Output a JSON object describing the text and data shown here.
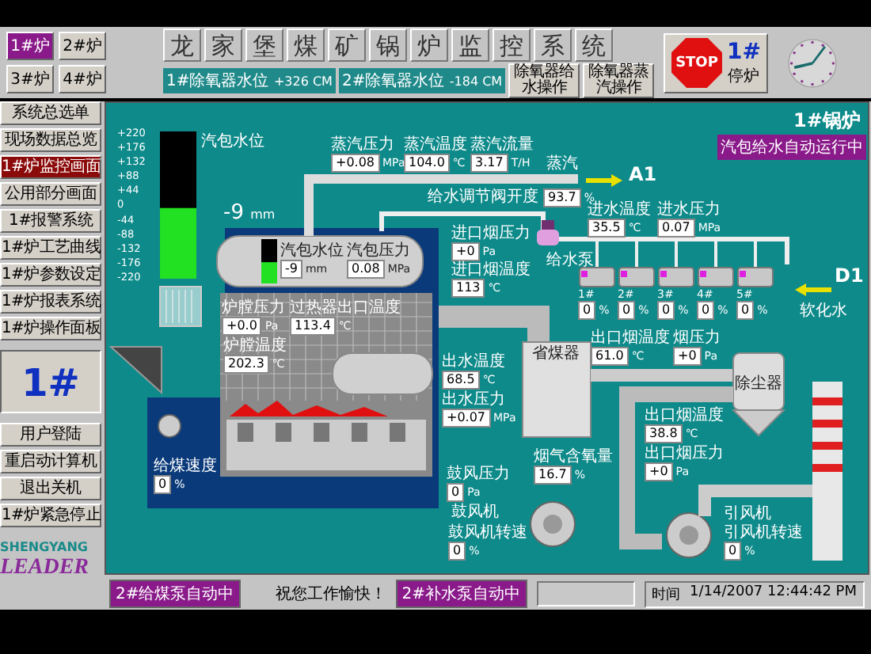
{
  "boiler_tabs": [
    {
      "label": "1#炉",
      "selected": true
    },
    {
      "label": "2#炉",
      "selected": false
    },
    {
      "label": "3#炉",
      "selected": false
    },
    {
      "label": "4#炉",
      "selected": false
    }
  ],
  "title": "龙家堡煤矿锅炉监控系统",
  "deaerator_levels": [
    {
      "label": "1#除氧器水位",
      "value": "+326 CM"
    },
    {
      "label": "2#除氧器水位",
      "value": "-184 CM"
    }
  ],
  "deaerator_buttons": [
    "除氧器给水操作",
    "除氧器蒸汽操作"
  ],
  "stop": {
    "label": "STOP",
    "unit": "1#",
    "caption": "停炉"
  },
  "sidebar": {
    "items": [
      {
        "label": "系统总选单",
        "selected": false
      },
      {
        "label": "现场数据总览",
        "selected": false
      },
      {
        "label": "1#炉监控画面",
        "selected": true
      },
      {
        "label": "公用部分画面",
        "selected": false
      },
      {
        "label": "1#报警系统",
        "selected": false
      },
      {
        "label": "1#炉工艺曲线",
        "selected": false
      },
      {
        "label": "1#炉参数设定",
        "selected": false
      },
      {
        "label": "1#炉报表系统",
        "selected": false
      },
      {
        "label": "1#炉操作面板",
        "selected": false
      }
    ],
    "unit": "1#",
    "actions": [
      "用户登陆",
      "重启动计算机",
      "退出关机",
      "1#炉紧急停止"
    ]
  },
  "logo": {
    "line1": "SHENGYANG",
    "line2": "LEADER"
  },
  "panel": {
    "title": "1#锅炉",
    "badge": "汽包给水自动运行中",
    "gauge": {
      "label": "汽包水位",
      "ticks": [
        "+220",
        "+176",
        "+132",
        "+88",
        "+44",
        "0",
        "-44",
        "-88",
        "-132",
        "-176",
        "-220"
      ],
      "level": 0.48,
      "reading": "-9",
      "unit": "mm"
    },
    "readouts": [
      {
        "label": "蒸汽压力",
        "value": "+0.08",
        "unit": "MPa"
      },
      {
        "label": "蒸汽温度",
        "value": "104.0",
        "unit": "℃"
      },
      {
        "label": "蒸汽流量",
        "value": "3.17",
        "unit": "T/H"
      },
      {
        "label": "给水调节阀开度",
        "value": "93.7",
        "unit": "%"
      },
      {
        "label": "进水温度",
        "value": "35.5",
        "unit": "℃"
      },
      {
        "label": "进水压力",
        "value": "0.07",
        "unit": "MPa"
      },
      {
        "label": "汽包水位",
        "value": "-9",
        "unit": "mm"
      },
      {
        "label": "汽包压力",
        "value": "0.08",
        "unit": "MPa"
      },
      {
        "label": "炉膛压力",
        "value": "+0.0",
        "unit": "Pa"
      },
      {
        "label": "过热器出口温度",
        "value": "113.4",
        "unit": "℃"
      },
      {
        "label": "炉膛温度",
        "value": "202.3",
        "unit": "℃"
      },
      {
        "label": "进口烟压力",
        "value": "+0",
        "unit": "Pa"
      },
      {
        "label": "进口烟温度",
        "value": "113",
        "unit": "℃"
      },
      {
        "label": "出水温度",
        "value": "68.5",
        "unit": "℃"
      },
      {
        "label": "出水压力",
        "value": "+0.07",
        "unit": "MPa"
      },
      {
        "label": "出口烟温度",
        "value": "61.0",
        "unit": "℃"
      },
      {
        "label": "烟压力",
        "value": "+0",
        "unit": "Pa"
      },
      {
        "label": "烟气含氧量",
        "value": "16.7",
        "unit": "%"
      },
      {
        "label": "出口烟温度",
        "value": "38.8",
        "unit": "℃"
      },
      {
        "label": "出口烟压力",
        "value": "+0",
        "unit": "Pa"
      },
      {
        "label": "鼓风压力",
        "value": "0",
        "unit": "Pa"
      },
      {
        "label": "鼓风机转速",
        "value": "0",
        "unit": "%"
      },
      {
        "label": "引风机转速",
        "value": "0",
        "unit": "%"
      },
      {
        "label": "给煤速度",
        "value": "0",
        "unit": "%"
      }
    ],
    "pumps": [
      {
        "label": "1#",
        "value": "0",
        "unit": "%"
      },
      {
        "label": "2#",
        "value": "0",
        "unit": "%"
      },
      {
        "label": "3#",
        "value": "0",
        "unit": "%"
      },
      {
        "label": "4#",
        "value": "0",
        "unit": "%"
      },
      {
        "label": "5#",
        "value": "0",
        "unit": "%"
      }
    ],
    "labels": [
      "蒸汽",
      "A1",
      "给水泵",
      "D1",
      "软化水",
      "省煤器",
      "除尘器",
      "鼓风机",
      "引风机"
    ]
  },
  "status_bar": {
    "left_badge": "2#给煤泵自动中",
    "message": "祝您工作愉快！",
    "right_badge": "2#补水泵自动中",
    "time_label": "时间",
    "time": "1/14/2007 12:44:42 PM"
  }
}
